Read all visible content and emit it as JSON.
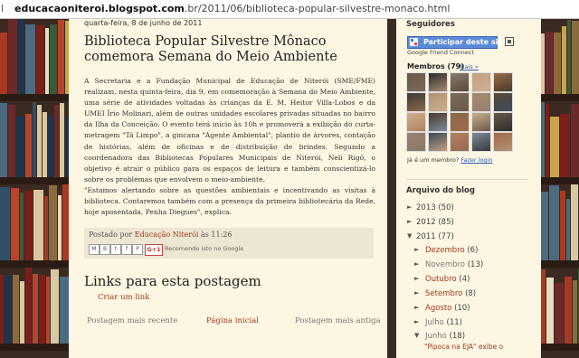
{
  "browser": {
    "url_prefix": "educacaoniteroi.blogspot.com",
    "url_rest": ".br/2011/06/biblioteca-popular-silvestre-monaco.html"
  },
  "post": {
    "date": "quarta-feira, 8 de junho de 2011",
    "title": "Biblioteca Popular Silvestre Mônaco comemora Semana do Meio Ambiente",
    "paragraphs": [
      "A Secretaria e a Fundação Municipal de Educação de Niterói (SME/FME) realizam, nesta quinta-feira, dia 9, em comemoração à Semana do Meio Ambiente, uma série de atividades voltadas às crianças da E. M. Heitor Villa-Lobos e da UMEI Írio Molinari, além de outras unidades escolares privadas situadas no bairro da Ilha da Conceição. O evento terá início às 10h e promoverá a exibição do curta-metragem \"Tá Limpo\", a gincana \"Agente Ambiental\", plantio de árvores, contação de histórias, além de oficinas e de distribuição de brindes. Segundo a coordenadora das Bibliotecas Populares Municipais de Niterói, Neli Rigô, o objetivo é atrair o público para os espaços de leitura e também conscientizá-lo sobre os problemas que envolvem o meio-ambiente.",
      "\"Estamos alertando sobre as questões ambientais e incentivando as visitas à biblioteca. Contaremos também com a presença da primeira bibliotecária da Rede, hoje aposentada, Penha Diegues\", explica."
    ],
    "posted_by_prefix": "Postado por",
    "author": "Educação Niterói",
    "posted_at_prefix": "às",
    "time": "11:26",
    "share_buttons": [
      "M",
      "B",
      "t",
      "f",
      "P"
    ],
    "gplus_label": "G+1",
    "recommend_text": "Recomende isto no Google"
  },
  "links_section": {
    "heading": "Links para esta postagem",
    "create_link": "Criar um link"
  },
  "pager": {
    "newer": "Postagem mais recente",
    "home": "Página inicial",
    "older": "Postagem mais antiga"
  },
  "sidebar": {
    "followers_heading": "Seguidores",
    "follow_button": "Participar deste site",
    "gfc_label": "Google Friend Connect",
    "members_label": "Membros (79)",
    "more_link": "Mais »",
    "member_question": "Já é um membro?",
    "login_link": "Fazer login",
    "archive_heading": "Arquivo do blog",
    "archive": [
      {
        "label": "2013",
        "count": "(50)",
        "state": "collapsed"
      },
      {
        "label": "2012",
        "count": "(85)",
        "state": "collapsed"
      },
      {
        "label": "2011",
        "count": "(77)",
        "state": "expanded"
      }
    ],
    "months": [
      {
        "label": "Dezembro",
        "count": "(6)"
      },
      {
        "label": "Novembro",
        "count": "(13)"
      },
      {
        "label": "Outubro",
        "count": "(4)"
      },
      {
        "label": "Setembro",
        "count": "(8)"
      },
      {
        "label": "Agosto",
        "count": "(10)"
      },
      {
        "label": "Julho",
        "count": "(11)"
      },
      {
        "label": "Junho",
        "count": "(18)"
      }
    ],
    "recent_post": "\"Pipoca na EJA\" exibe o"
  },
  "colors": {
    "page_bg": "#fdf6e3",
    "link": "#a03b1e",
    "follow_button": "#5b8bd8"
  }
}
